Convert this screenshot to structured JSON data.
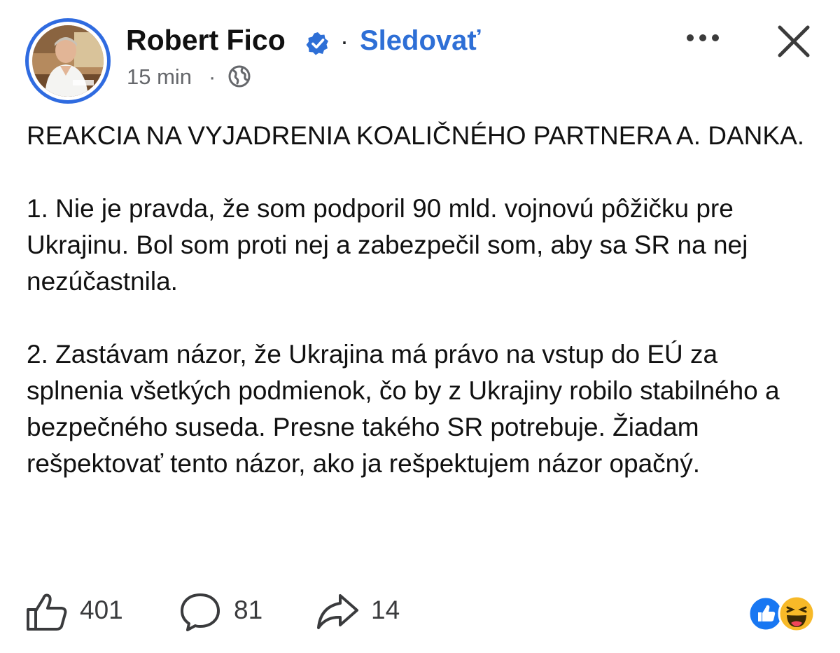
{
  "post": {
    "author": "Robert Fico",
    "follow_label": "Sledovať",
    "separator": "·",
    "time": "15 min",
    "time_separator": "·",
    "audience_icon": "globe-icon",
    "verified_icon": "verified-badge-icon",
    "menu_icon": "more-horizontal-icon",
    "close_icon": "close-icon",
    "paragraphs": [
      "REAKCIA NA VYJADRENIA KOALIČNÉHO PARTNERA A. DANKA.",
      "1. Nie je pravda, že som podporil 90 mld. vojnovú pôžičku pre Ukrajinu. Bol som proti nej a zabezpečil som, aby sa SR na nej nezúčastnila.",
      "2. Zastávam názor, že Ukrajina má právo na vstup do EÚ za splnenia všetkých podmienok, čo by z Ukrajiny robilo stabilného a bezpečného suseda. Presne takého SR potrebuje. Žiadam rešpektovať tento názor, ako ja rešpektujem názor opačný."
    ]
  },
  "actions": {
    "like_count": "401",
    "like_icon": "thumbs-up-icon",
    "comment_count": "81",
    "comment_icon": "comment-bubble-icon",
    "share_count": "14",
    "share_icon": "share-arrow-icon",
    "reaction_icons": [
      "like-reaction-icon",
      "haha-reaction-icon"
    ]
  },
  "colors": {
    "accent": "#2e6fd6",
    "avatar_ring": "#2f6be0",
    "muted_text": "#65676b",
    "like_reaction": "#1877f2",
    "haha_reaction": "#f7b928"
  }
}
